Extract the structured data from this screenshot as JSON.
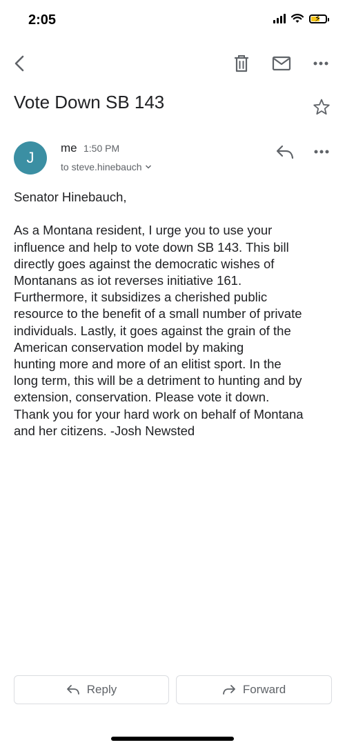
{
  "status_bar": {
    "time": "2:05",
    "battery_color": "#f5c518",
    "battery_level": 0.6,
    "icons": [
      "cellular-signal-icon",
      "wifi-icon",
      "battery-charging-icon"
    ]
  },
  "toolbar": {
    "icons": [
      "back-arrow-icon",
      "trash-icon",
      "mail-icon",
      "more-options-icon"
    ]
  },
  "email": {
    "subject": "Vote Down SB 143",
    "avatar_initial": "J",
    "avatar_color": "#3b8fa3",
    "sender": "me",
    "time": "1:50 PM",
    "recipient": "to steve.hinebauch",
    "greeting": "Senator Hinebauch,",
    "lines": [
      "As a Montana resident, I urge you to use your",
      "influence and help to vote down SB 143.  This bill",
      "directly goes against the democratic wishes of",
      "Montanans as iot reverses initiative 161.",
      "Furthermore, it subsidizes a cherished public",
      "resource to the benefit of a small number of private",
      "individuals.  Lastly, it goes against the grain of the",
      "American conservation model by making",
      "hunting more and more of an elitist sport.  In the",
      "long term, this will be a detriment to hunting and by",
      "extension, conservation.  Please vote it down.",
      "Thank you for your hard work on behalf of Montana",
      "and her citizens.  -Josh Newsted"
    ]
  },
  "actions": {
    "reply_label": "Reply",
    "forward_label": "Forward"
  }
}
